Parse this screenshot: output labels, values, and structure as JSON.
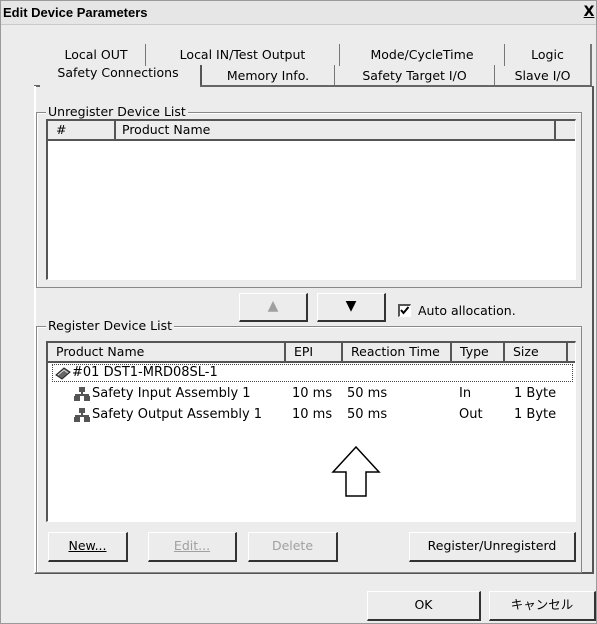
{
  "window": {
    "title": "Edit Device Parameters",
    "close_glyph": "X"
  },
  "tabs": {
    "row1": [
      "Local OUT",
      "Local IN/Test Output",
      "Mode/CycleTime",
      "Logic"
    ],
    "row2": [
      "Safety Connections",
      "Memory Info.",
      "Safety Target I/O",
      "Slave I/O"
    ],
    "active": "Safety Connections"
  },
  "unregister": {
    "label": "Unregister Device List",
    "columns": [
      "#",
      "Product Name"
    ]
  },
  "move": {
    "up_glyph": "▲",
    "down_glyph": "▼",
    "auto_allocation_label": "Auto allocation.",
    "auto_allocation_checked": true
  },
  "register": {
    "label": "Register Device List",
    "columns": [
      "Product Name",
      "EPI",
      "Reaction Time",
      "Type",
      "Size"
    ],
    "device": "#01 DST1-MRD08SL-1",
    "rows": [
      {
        "name": "Safety Input Assembly 1",
        "epi": "10 ms",
        "reaction": "50 ms",
        "type": "In",
        "size": "1 Byte"
      },
      {
        "name": "Safety Output Assembly 1",
        "epi": "10 ms",
        "reaction": "50 ms",
        "type": "Out",
        "size": "1 Byte"
      }
    ]
  },
  "buttons": {
    "new": "New...",
    "edit": "Edit...",
    "delete": "Delete",
    "register_unregister": "Register/Unregisterd",
    "ok": "OK",
    "cancel": "キャンセル"
  },
  "colors": {
    "dialog_bg": "#ececec",
    "list_bg": "#ffffff",
    "disabled_text": "#a0a0a0"
  }
}
